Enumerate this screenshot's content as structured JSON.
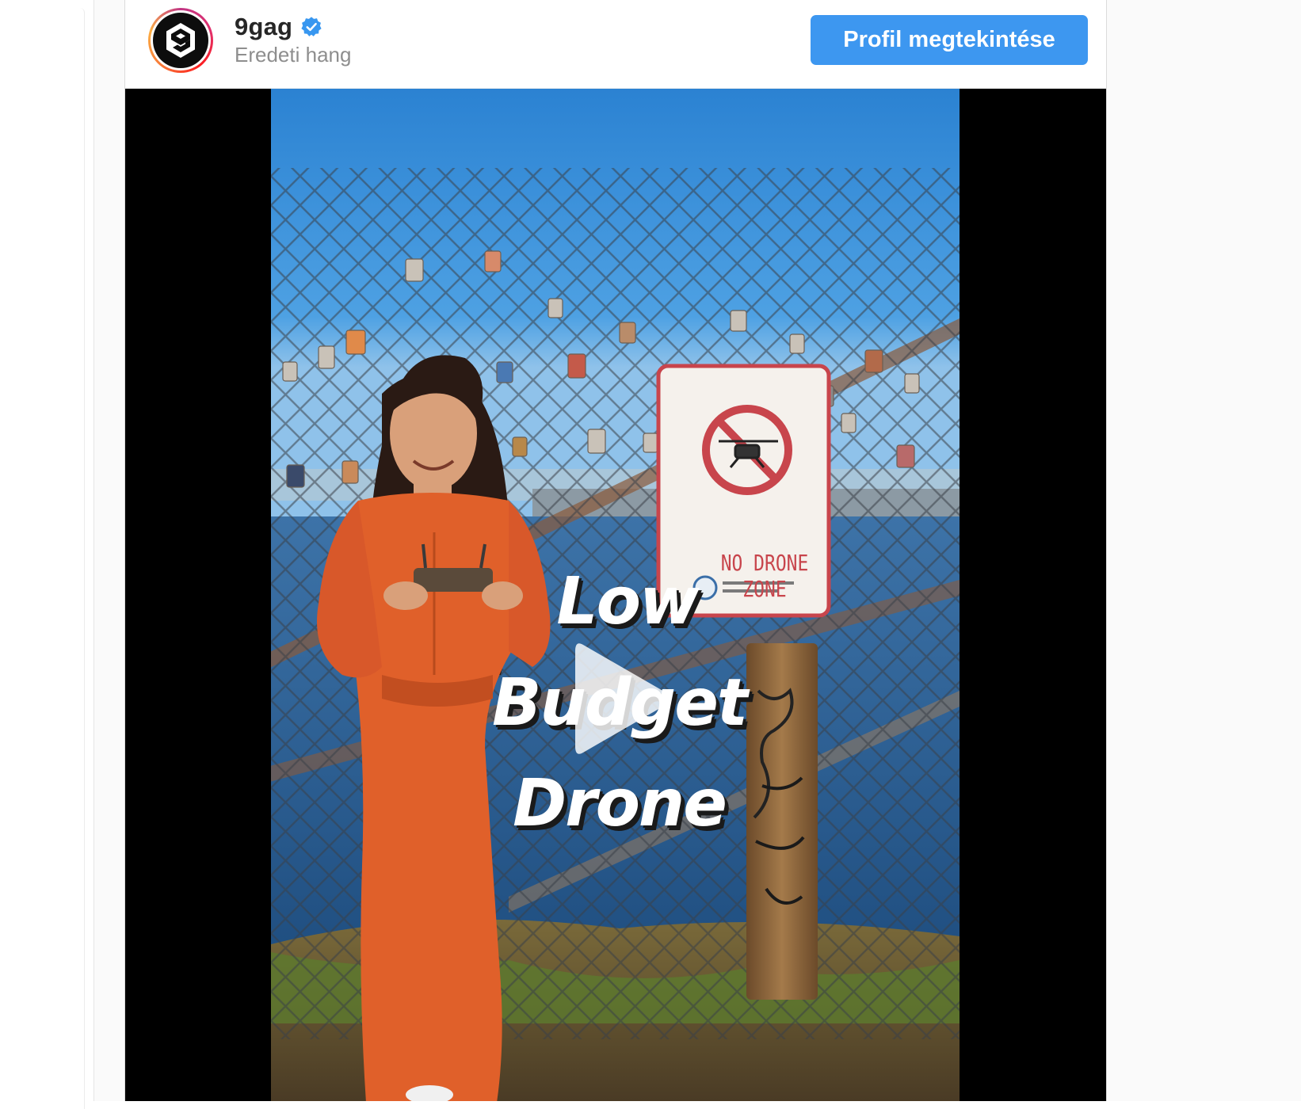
{
  "embed": {
    "account": {
      "username": "9gag",
      "verified": true,
      "audio_label": "Eredeti hang",
      "avatar_icon": "9gag-logo-icon"
    },
    "profile_button_label": "Profil megtekintése",
    "video": {
      "overlay_lines": [
        "Low",
        "Budget",
        "Drone"
      ],
      "sign_text": "NO DRONE ZONE",
      "play_icon": "play-icon"
    }
  },
  "colors": {
    "button_blue": "#3d97f0",
    "verified_blue": "#3897f0",
    "text_primary": "#262626",
    "text_secondary": "#8e8e8e",
    "sky": "#2f8fd8",
    "jumpsuit": "#e0602a"
  }
}
